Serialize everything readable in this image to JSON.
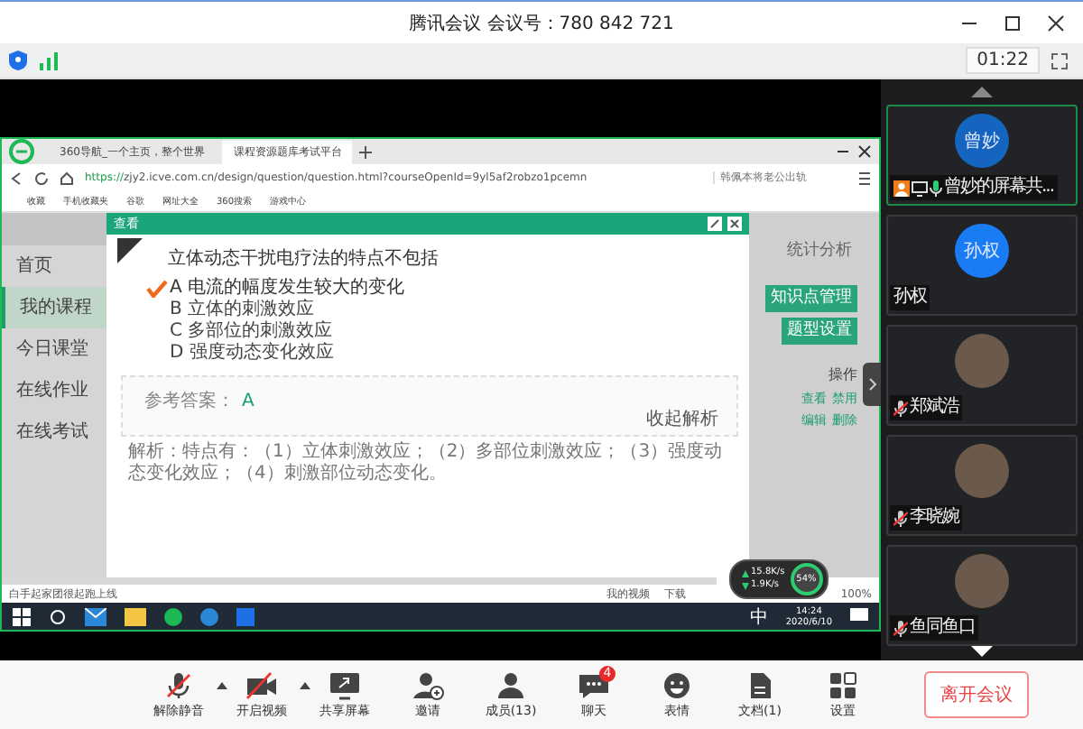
{
  "window": {
    "title": "腾讯会议 会议号：780 842 721",
    "timer": "01:22"
  },
  "shared_screen": {
    "browser": {
      "tabs": [
        {
          "label": "360导航_一个主页，整个世界",
          "selected": false
        },
        {
          "label": "课程资源题库考试平台",
          "selected": true
        }
      ],
      "url_secure": "https://",
      "url_rest": "zjy2.icve.com.cn/design/question/question.html?courseOpenId=9yl5af2robzo1pcemn",
      "search_placeholder": "韩佩本将老公出轨",
      "bookmarks": [
        "收藏",
        "手机收藏夹",
        "谷歌",
        "网址大全",
        "360搜索",
        "游戏中心"
      ]
    },
    "sidebar": {
      "items": [
        {
          "label": "首页",
          "selected": false
        },
        {
          "label": "我的课程",
          "selected": true
        },
        {
          "label": "今日课堂",
          "selected": false
        },
        {
          "label": "在线作业",
          "selected": false
        },
        {
          "label": "在线考试",
          "selected": false
        }
      ]
    },
    "side_buttons": [
      {
        "label": "统计分析",
        "kind": "plain"
      },
      {
        "label": "知识点管理",
        "kind": "green"
      },
      {
        "label": "题型设置",
        "kind": "green"
      }
    ],
    "table": {
      "header": "操作",
      "actions": [
        "查看",
        "禁用",
        "编辑",
        "删除"
      ]
    },
    "dialog": {
      "title": "查看",
      "question": "立体动态干扰电疗法的特点不包括",
      "options": [
        {
          "letter": "A",
          "text": "电流的幅度发生较大的变化",
          "selected": true
        },
        {
          "letter": "B",
          "text": "立体的刺激效应",
          "selected": false
        },
        {
          "letter": "C",
          "text": "多部位的刺激效应",
          "selected": false
        },
        {
          "letter": "D",
          "text": "强度动态变化效应",
          "selected": false
        }
      ],
      "answer_label": "参考答案：",
      "answer": "A",
      "collapse_link": "收起解析",
      "analysis": "解析：特点有：（1）立体刺激效应；（2）多部位刺激效应；（3）强度动态变化效应；（4）刺激部位动态变化。"
    },
    "status_bar": {
      "text": "白手起家团很起跑上线",
      "video": "我的视频",
      "download": "下载",
      "zoom": "100%"
    },
    "taskbar": {
      "ime": "中",
      "time": "14:24",
      "date": "2020/6/10"
    },
    "speed_widget": {
      "up": "15.8K/s",
      "down": "1.9K/s",
      "percent": "54%"
    }
  },
  "participants": [
    {
      "label": "曾妙的屏幕共...",
      "avatar_text": "曾妙",
      "kind": "text",
      "color": "#1565c0",
      "mic_on": true,
      "muted": false,
      "host": true,
      "selected": true
    },
    {
      "label": "孙权",
      "avatar_text": "孙权",
      "kind": "text",
      "color": "#1a7cf5",
      "mic_on": false,
      "muted": false,
      "host": false,
      "selected": false
    },
    {
      "label": "郑斌浩",
      "kind": "photo",
      "mic_on": false,
      "muted": true,
      "host": false,
      "selected": false
    },
    {
      "label": "李晓婉",
      "kind": "photo",
      "mic_on": false,
      "muted": true,
      "host": false,
      "selected": false
    },
    {
      "label": "鱼同鱼口",
      "kind": "photo",
      "mic_on": false,
      "muted": true,
      "host": false,
      "selected": false
    }
  ],
  "toolbar": {
    "items": [
      {
        "label": "解除静音",
        "kind": "mic",
        "caret": true
      },
      {
        "label": "开启视频",
        "kind": "video",
        "caret": true
      },
      {
        "label": "共享屏幕",
        "kind": "share",
        "caret": false
      },
      {
        "label": "邀请",
        "kind": "invite",
        "caret": false
      },
      {
        "label": "成员(13)",
        "kind": "members",
        "caret": false
      },
      {
        "label": "聊天",
        "kind": "chat",
        "caret": false,
        "badge": "4"
      },
      {
        "label": "表情",
        "kind": "emoji",
        "caret": false
      },
      {
        "label": "文档(1)",
        "kind": "doc",
        "caret": false
      },
      {
        "label": "设置",
        "kind": "settings",
        "caret": false
      }
    ],
    "leave": "离开会议"
  }
}
